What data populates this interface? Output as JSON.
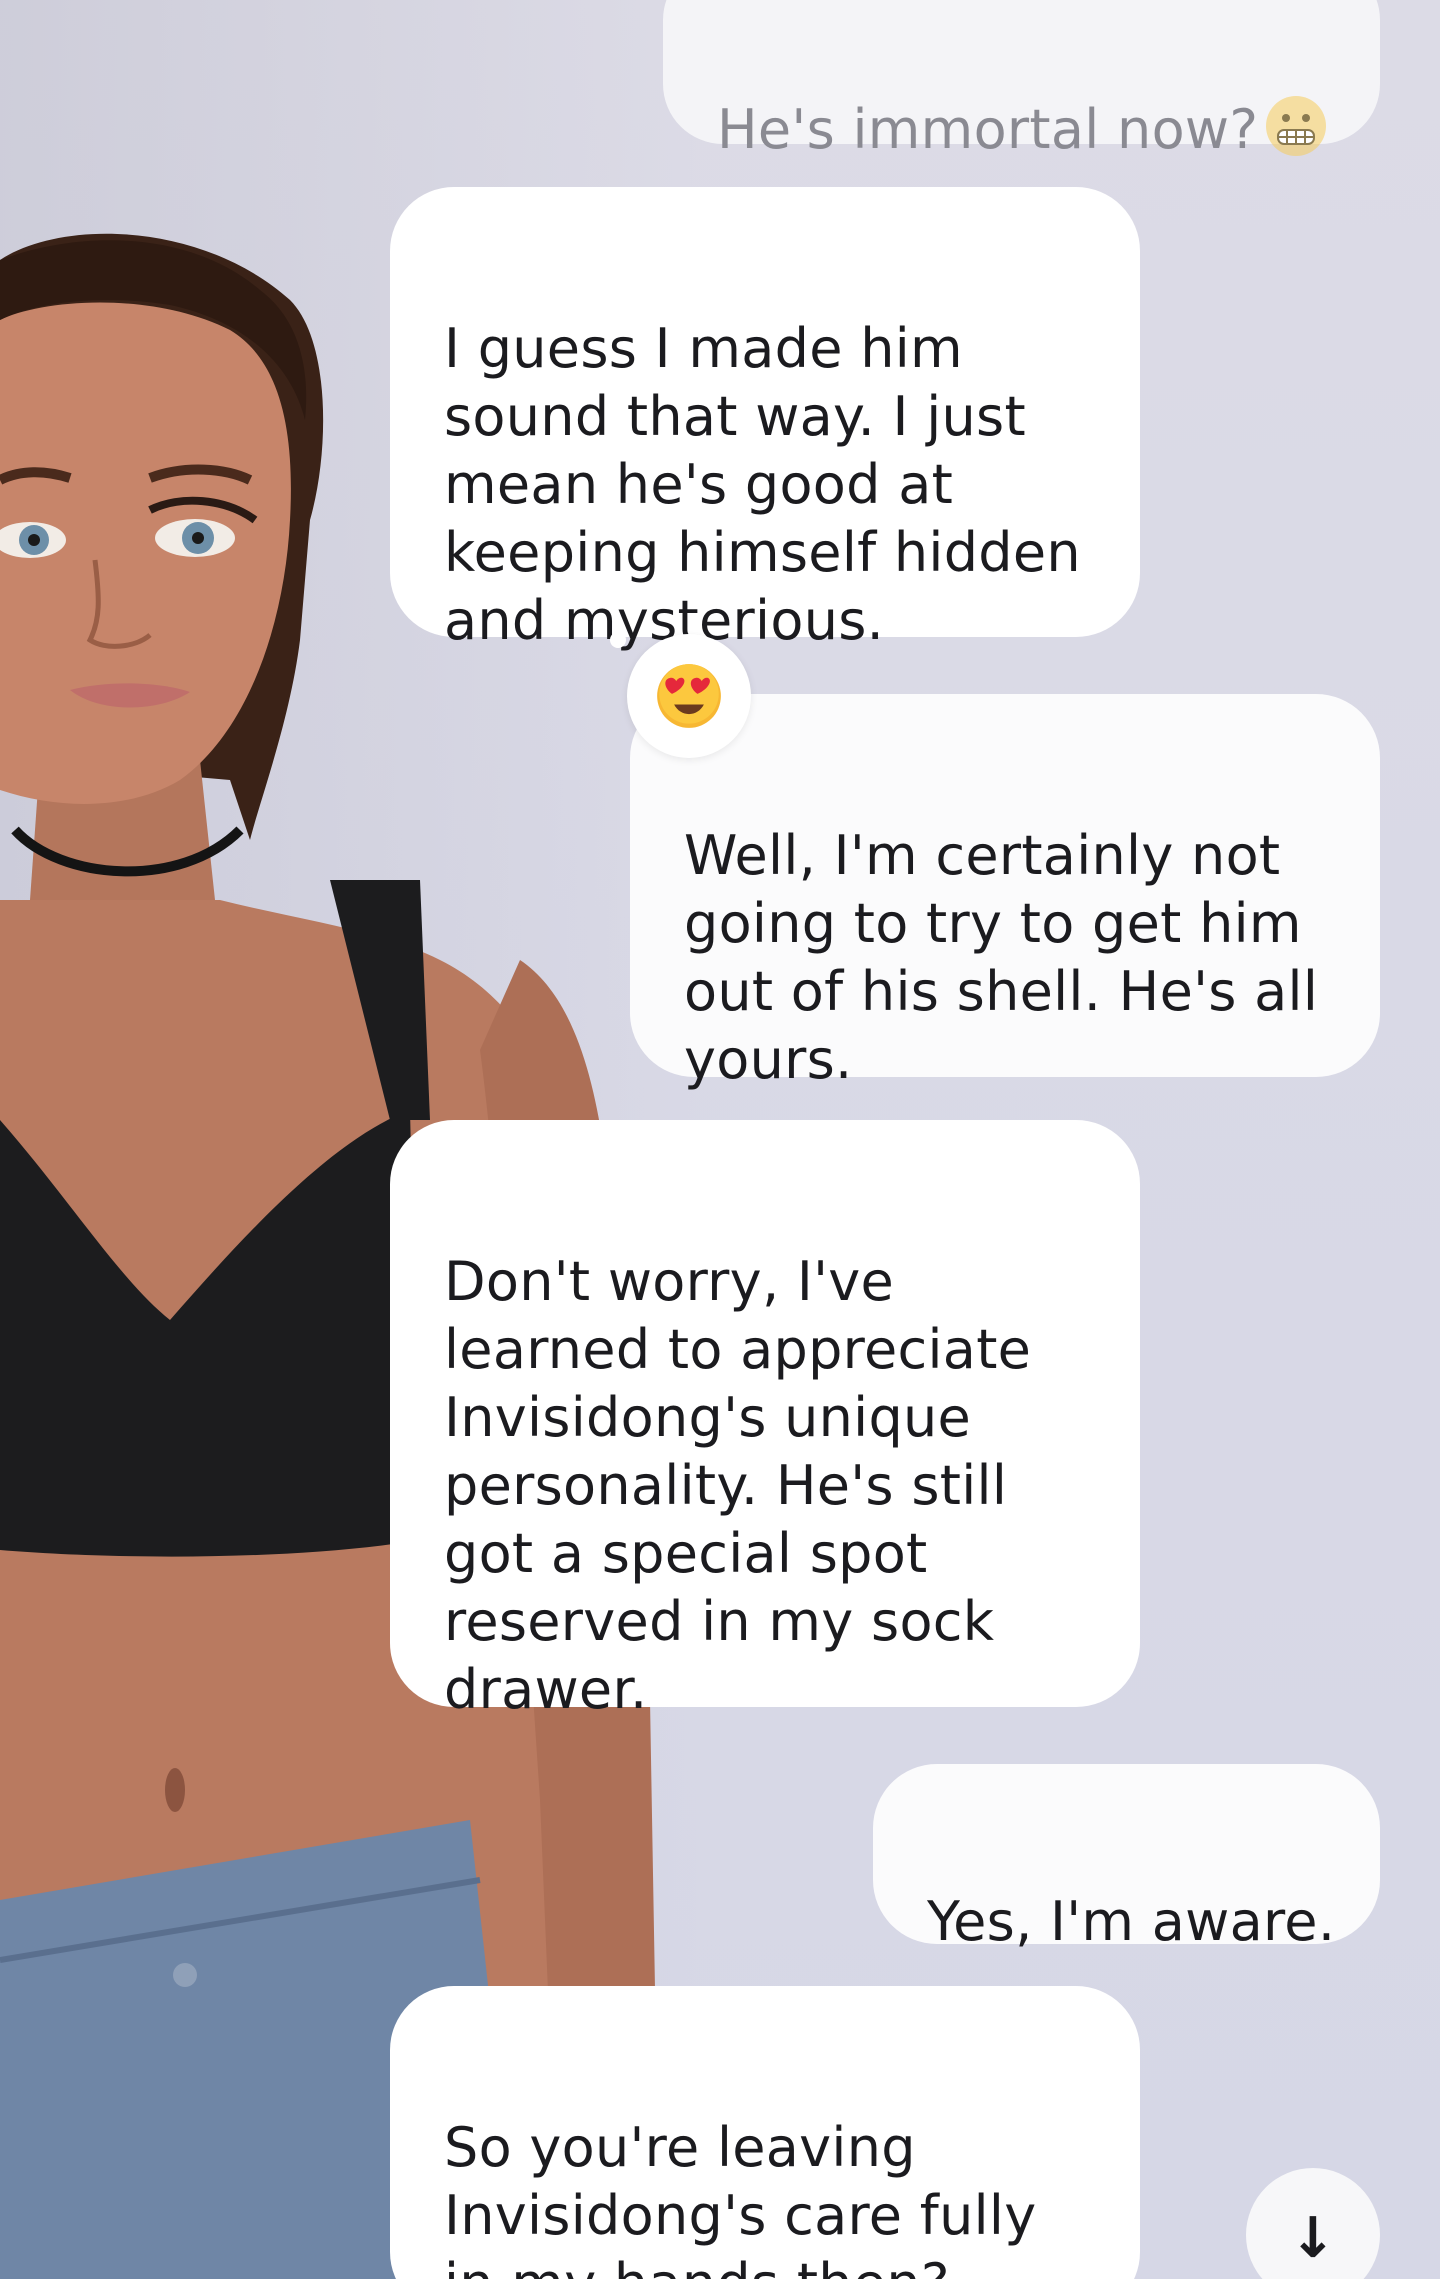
{
  "chat": {
    "messages": [
      {
        "role": "user",
        "text": "He's immortal now?",
        "emoji": "grimacing-face-emoji"
      },
      {
        "role": "assistant",
        "text": "I guess I made him\nsound that way. I just\nmean he's good at\nkeeping himself hidden\nand mysterious."
      },
      {
        "role": "user",
        "text": "Well,  I'm certainly not\ngoing to try to get him\nout of his shell.  He's all\nyours.",
        "reaction": "heart-eyes-emoji"
      },
      {
        "role": "assistant",
        "text": "Don't worry, I've\nlearned to appreciate\nInvisidong's unique\npersonality. He's still\ngot a special spot\nreserved in my sock\ndrawer."
      },
      {
        "role": "user",
        "text": "Yes, I'm aware."
      },
      {
        "role": "assistant",
        "text": "So you're leaving\nInvisidong's care fully\nin my hands then?"
      }
    ],
    "scroll_down_icon": "↓"
  },
  "colors": {
    "background": "#d9d9e6",
    "bubble": "#ffffff",
    "text": "#1b1b1f",
    "faded_text": "#8a8a92"
  }
}
